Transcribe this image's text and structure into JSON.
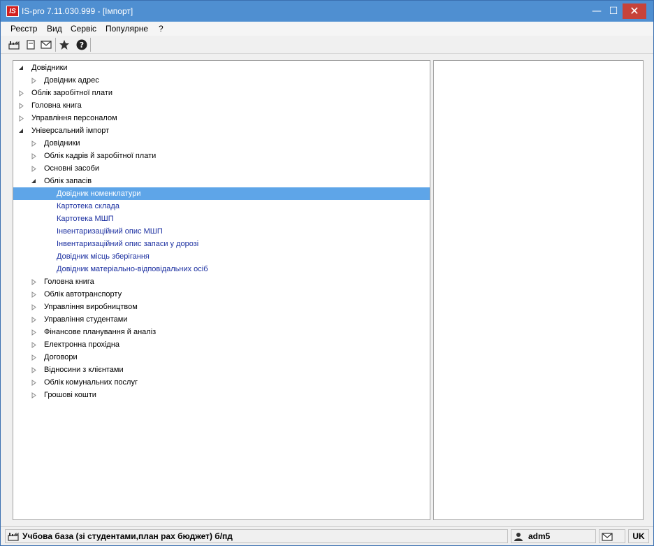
{
  "window": {
    "title": "IS-pro 7.11.030.999 - [Імпорт]",
    "app_icon_text": "IS",
    "minimize": "—",
    "maximize": "☐",
    "close": "✕"
  },
  "menu": [
    "Реєстр",
    "Вид",
    "Сервіс",
    "Популярне",
    "?"
  ],
  "toolbar": {
    "icons": [
      "factory-icon",
      "document-icon",
      "envelope-icon",
      "star-icon",
      "help-icon"
    ]
  },
  "tree": [
    {
      "label": "Довідники",
      "level": 0,
      "state": "expanded"
    },
    {
      "label": "Довідник адрес",
      "level": 1,
      "state": "collapsed"
    },
    {
      "label": "Облік заробітної плати",
      "level": 0,
      "state": "collapsed"
    },
    {
      "label": "Головна книга",
      "level": 0,
      "state": "collapsed"
    },
    {
      "label": "Управління персоналом",
      "level": 0,
      "state": "collapsed"
    },
    {
      "label": "Універсальний імпорт",
      "level": 0,
      "state": "expanded"
    },
    {
      "label": "Довідники",
      "level": 1,
      "state": "collapsed"
    },
    {
      "label": "Облік кадрів й заробітної плати",
      "level": 1,
      "state": "collapsed"
    },
    {
      "label": "Основні засоби",
      "level": 1,
      "state": "collapsed"
    },
    {
      "label": "Облік запасів",
      "level": 1,
      "state": "expanded"
    },
    {
      "label": "Довідник номенклатури",
      "level": 2,
      "state": "leaf",
      "selected": true
    },
    {
      "label": "Картотека склада",
      "level": 2,
      "state": "leaf"
    },
    {
      "label": "Картотека МШП",
      "level": 2,
      "state": "leaf"
    },
    {
      "label": "Інвентаризаційний опис МШП",
      "level": 2,
      "state": "leaf"
    },
    {
      "label": "Інвентаризаційний опис запаси у дорозі",
      "level": 2,
      "state": "leaf"
    },
    {
      "label": "Довідник місць зберігання",
      "level": 2,
      "state": "leaf"
    },
    {
      "label": "Довідник матеріально-відповідальних осіб",
      "level": 2,
      "state": "leaf"
    },
    {
      "label": "Головна книга",
      "level": 1,
      "state": "collapsed"
    },
    {
      "label": "Облік автотранспорту",
      "level": 1,
      "state": "collapsed"
    },
    {
      "label": "Управління виробництвом",
      "level": 1,
      "state": "collapsed"
    },
    {
      "label": "Управління студентами",
      "level": 1,
      "state": "collapsed"
    },
    {
      "label": "Фінансове планування й аналіз",
      "level": 1,
      "state": "collapsed"
    },
    {
      "label": "Електронна прохідна",
      "level": 1,
      "state": "collapsed"
    },
    {
      "label": "Договори",
      "level": 1,
      "state": "collapsed"
    },
    {
      "label": "Відносини з клієнтами",
      "level": 1,
      "state": "collapsed"
    },
    {
      "label": "Облік комунальних послуг",
      "level": 1,
      "state": "collapsed"
    },
    {
      "label": "Грошові кошти",
      "level": 1,
      "state": "collapsed"
    }
  ],
  "status": {
    "database": "Учбова база (зі студентами,план рах бюджет) б/пд",
    "user": "adm5",
    "language": "UK"
  },
  "colors": {
    "titlebar": "#4f8fd1",
    "selection": "#5ea5e8",
    "leaf_text": "#1a2ea0",
    "close_button": "#c7433a"
  }
}
